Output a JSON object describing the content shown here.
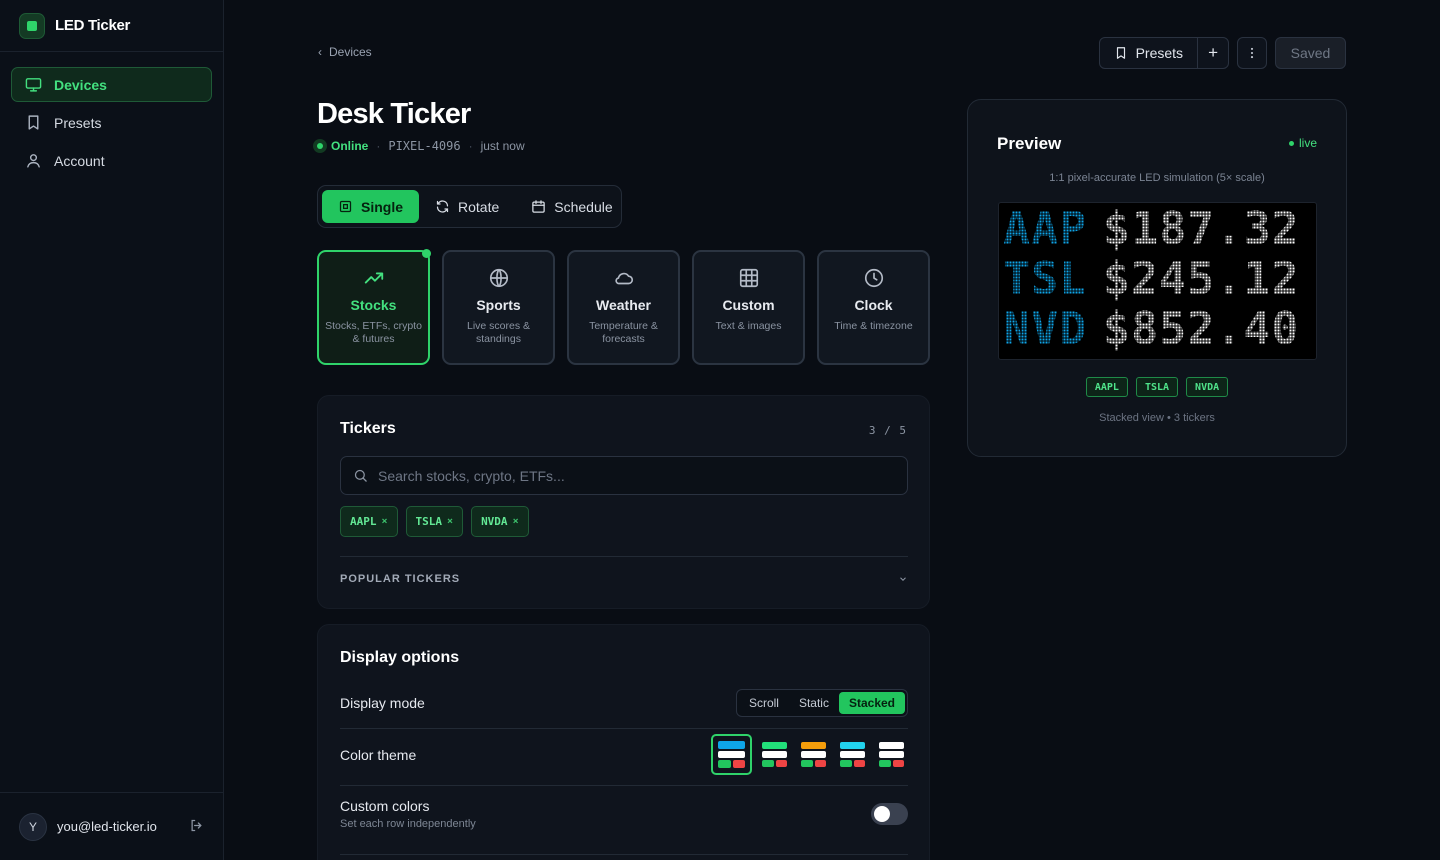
{
  "app": {
    "name": "LED Ticker"
  },
  "sidebar": {
    "items": [
      {
        "label": "Devices",
        "icon": "monitor-icon",
        "active": true
      },
      {
        "label": "Presets",
        "icon": "bookmark-icon",
        "active": false
      },
      {
        "label": "Account",
        "icon": "user-icon",
        "active": false
      }
    ],
    "user": {
      "initial": "Y",
      "email": "you@led-ticker.io"
    }
  },
  "breadcrumb": {
    "label": "Devices"
  },
  "toolbar": {
    "presets_label": "Presets",
    "add_label": "+",
    "saved_label": "Saved"
  },
  "device": {
    "title": "Desk Ticker",
    "status": "Online",
    "serial": "PIXEL-4096",
    "updated": "just now"
  },
  "modes": [
    {
      "label": "Single",
      "active": true
    },
    {
      "label": "Rotate",
      "active": false
    },
    {
      "label": "Schedule",
      "active": false
    }
  ],
  "sources": [
    {
      "title": "Stocks",
      "sub": "Stocks, ETFs, crypto & futures",
      "active": true
    },
    {
      "title": "Sports",
      "sub": "Live scores & standings",
      "active": false
    },
    {
      "title": "Weather",
      "sub": "Temperature & forecasts",
      "active": false
    },
    {
      "title": "Custom",
      "sub": "Text & images",
      "active": false
    },
    {
      "title": "Clock",
      "sub": "Time & timezone",
      "active": false
    }
  ],
  "tickers": {
    "title": "Tickers",
    "count": "3 / 5",
    "search_placeholder": "Search stocks, crypto, ETFs...",
    "chips": [
      "AAPL",
      "TSLA",
      "NVDA"
    ],
    "chip_remove": "×",
    "popular_label": "POPULAR TICKERS"
  },
  "display": {
    "title": "Display options",
    "mode_label": "Display mode",
    "modes": [
      {
        "label": "Scroll",
        "active": false
      },
      {
        "label": "Static",
        "active": false
      },
      {
        "label": "Stacked",
        "active": true
      }
    ],
    "theme_label": "Color theme",
    "themes": [
      {
        "top": "#0ea5e9",
        "mid": "#ffffff",
        "up": "#22c55e",
        "down": "#ef4444",
        "active": true
      },
      {
        "top": "#22e07a",
        "mid": "#ffffff",
        "up": "#22c55e",
        "down": "#ef4444",
        "active": false
      },
      {
        "top": "#f59e0b",
        "mid": "#ffffff",
        "up": "#22c55e",
        "down": "#ef4444",
        "active": false
      },
      {
        "top": "#22d3ee",
        "mid": "#ffffff",
        "up": "#22c55e",
        "down": "#ef4444",
        "active": false
      },
      {
        "top": "#ffffff",
        "mid": "#ffffff",
        "up": "#22c55e",
        "down": "#ef4444",
        "active": false
      }
    ],
    "custom_label": "Custom colors",
    "custom_sub": "Set each row independently",
    "custom_enabled": false
  },
  "preview": {
    "title": "Preview",
    "live": "live",
    "caption": "1:1 pixel-accurate LED simulation (5× scale)",
    "rows": [
      {
        "sym": "AAP",
        "price": "$187.32"
      },
      {
        "sym": "TSL",
        "price": "$245.12"
      },
      {
        "sym": "NVD",
        "price": "$852.40"
      }
    ],
    "tags": [
      "AAPL",
      "TSLA",
      "NVDA"
    ],
    "footer": "Stacked view • 3 tickers"
  },
  "colors": {
    "accent": "#22c55e",
    "led_symbol": "#0ea5e9",
    "led_price": "#ffffff"
  }
}
